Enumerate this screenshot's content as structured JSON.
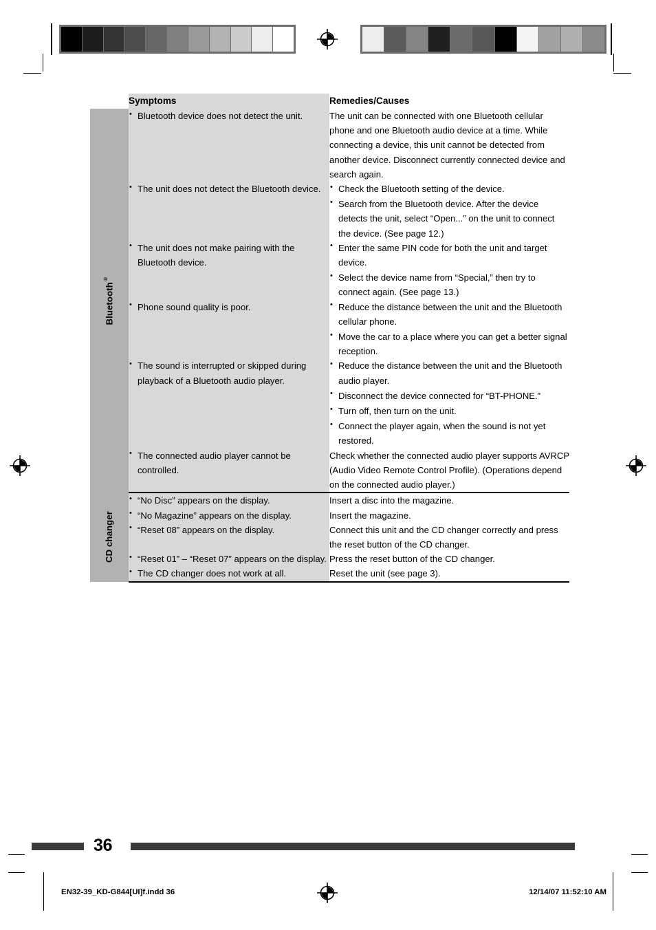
{
  "page": {
    "number": "36",
    "slug_left": "EN32-39_KD-G844[UI]f.indd   36",
    "slug_right": "12/14/07   11:52:10 AM"
  },
  "calibration": {
    "left_strip": [
      "#000000",
      "#1b1b1b",
      "#333333",
      "#4d4d4d",
      "#666666",
      "#808080",
      "#999999",
      "#b3b3b3",
      "#cccccc",
      "#ececec",
      "#ffffff"
    ],
    "right_strip": [
      "#ececec",
      "#5a5a5a",
      "#848484",
      "#1f1f1f",
      "#6b6b6b",
      "#575757",
      "#000000",
      "#f4f4f4",
      "#a2a2a2",
      "#b0b0b0",
      "#8a8a8a"
    ]
  },
  "table": {
    "headers": {
      "symptoms": "Symptoms",
      "remedies": "Remedies/Causes"
    },
    "sections": [
      {
        "category": "Bluetooth",
        "category_sup": "®",
        "rows": [
          {
            "symptom_bullets": [
              "Bluetooth device does not detect the unit."
            ],
            "remedy_plain": "The unit can be connected with one Bluetooth cellular phone and one Bluetooth audio device at a time. While connecting a device, this unit cannot be detected from another device. Disconnect currently connected device and search again."
          },
          {
            "symptom_bullets": [
              "The unit does not detect the Bluetooth device."
            ],
            "remedy_bullets": [
              "Check the Bluetooth setting of the device.",
              "Search from the Bluetooth device. After the device detects the unit, select “Open...” on the unit to connect the device. (See page 12.)"
            ]
          },
          {
            "symptom_bullets": [
              "The unit does not make pairing with the Bluetooth device."
            ],
            "remedy_bullets": [
              "Enter the same PIN code for both the unit and target device.",
              "Select the device name from “Special,” then try to connect again. (See page 13.)"
            ]
          },
          {
            "symptom_bullets": [
              "Phone sound quality is poor."
            ],
            "remedy_bullets": [
              "Reduce the distance between the unit and the Bluetooth cellular phone.",
              "Move the car to a place where you can get a better signal reception."
            ]
          },
          {
            "symptom_bullets": [
              "The sound is interrupted or skipped during playback of a Bluetooth audio player."
            ],
            "remedy_bullets": [
              "Reduce the distance between the unit and the Bluetooth audio player.",
              "Disconnect the device connected for “BT-PHONE.”",
              "Turn off, then turn on the unit.",
              "Connect the player again, when the sound is not yet restored."
            ]
          },
          {
            "symptom_bullets": [
              "The connected audio player cannot be controlled."
            ],
            "remedy_plain": "Check whether the connected audio player supports AVRCP (Audio Video Remote Control Profile). (Operations depend on the connected audio player.)"
          }
        ]
      },
      {
        "category": "CD changer",
        "category_sup": "",
        "rows": [
          {
            "symptom_bullets": [
              "“No Disc” appears on the display."
            ],
            "remedy_plain": "Insert a disc into the magazine."
          },
          {
            "symptom_bullets": [
              "“No Magazine” appears on the display."
            ],
            "remedy_plain": "Insert the magazine."
          },
          {
            "symptom_bullets": [
              "“Reset 08” appears on the display."
            ],
            "remedy_plain": "Connect this unit and the CD changer correctly and press the reset button of the CD changer."
          },
          {
            "symptom_bullets": [
              "“Reset 01” – “Reset 07” appears on the display."
            ],
            "remedy_plain": "Press the reset button of the CD changer."
          },
          {
            "symptom_bullets": [
              "The CD changer does not work at all."
            ],
            "remedy_plain": "Reset the unit (see page 3)."
          }
        ]
      }
    ]
  }
}
